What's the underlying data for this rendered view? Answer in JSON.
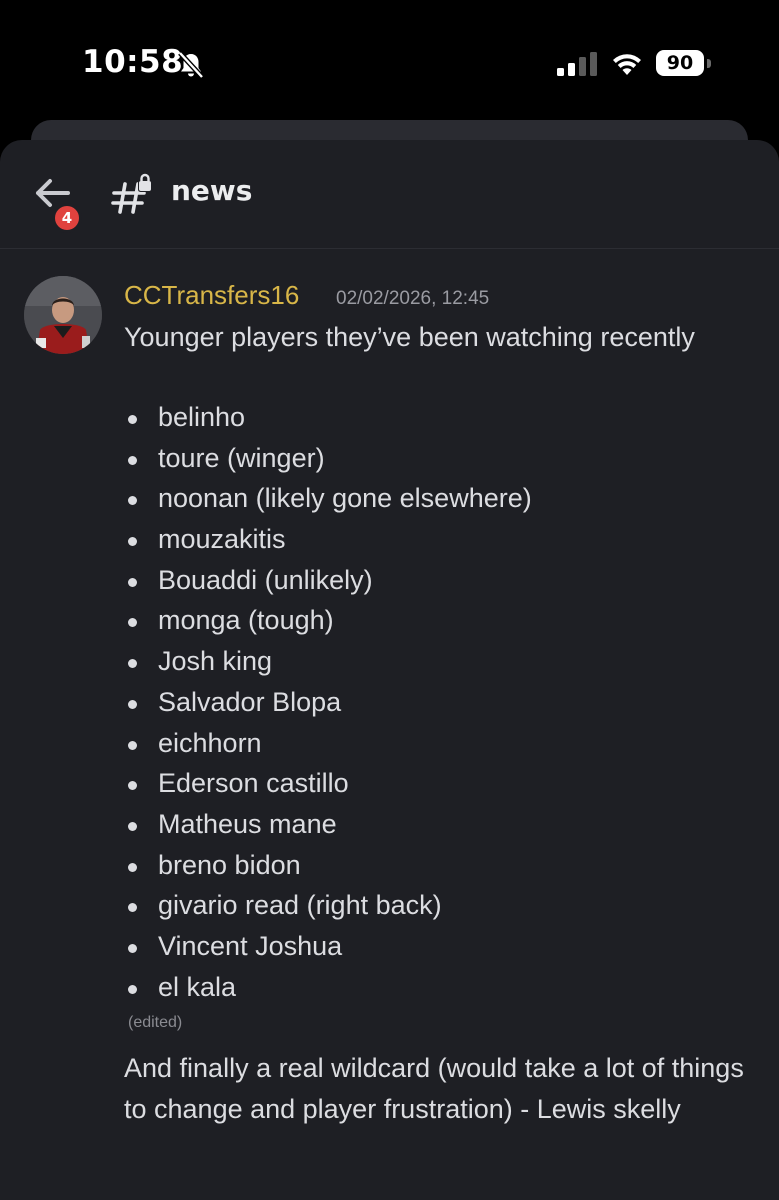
{
  "status_bar": {
    "time": "10:58",
    "battery": "90",
    "icons": [
      "bell-slash-icon",
      "cellular-signal-icon",
      "wifi-icon",
      "battery-icon"
    ]
  },
  "header": {
    "back_icon": "arrow-left-icon",
    "unread_badge": "4",
    "channel_icon": "hashtag-lock-icon",
    "channel_name": "news"
  },
  "message": {
    "author": "CCTransfers16",
    "timestamp": "02/02/2026, 12:45",
    "intro": "Younger players they’ve been watching recently",
    "items": [
      "belinho",
      "toure (winger)",
      "noonan (likely gone elsewhere)",
      "mouzakitis",
      "Bouaddi (unlikely)",
      "monga (tough)",
      "Josh king",
      "Salvador Blopa",
      "eichhorn",
      "Ederson castillo",
      "Matheus mane",
      "breno bidon",
      "givario read (right back)",
      "Vincent Joshua",
      "el kala"
    ],
    "edited": "(edited)",
    "final": "And finally a real wildcard (would take a lot of things to change and player frustration) - Lewis skelly"
  },
  "colors": {
    "panel_bg": "#1e1f24",
    "author_color": "#d8b648",
    "badge_red": "#e0423e",
    "text": "#dcdde1"
  }
}
